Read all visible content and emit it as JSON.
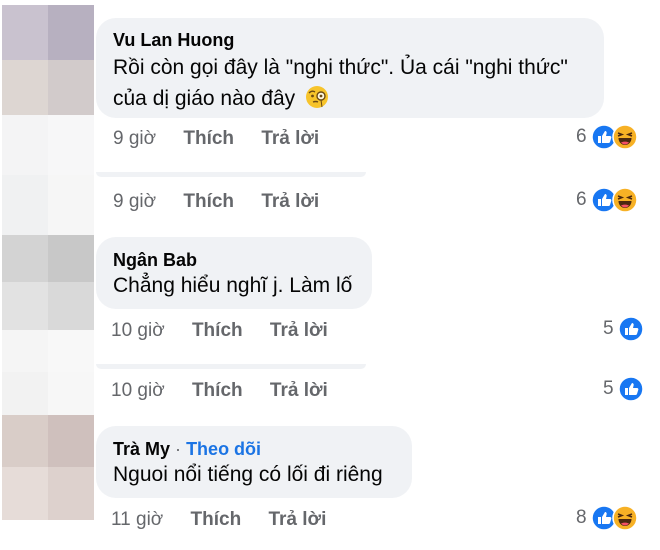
{
  "comments": [
    {
      "author": "Vu Lan Huong",
      "line1": "Rồi còn gọi đây là \"nghi thức\". Ủa cái \"nghi thức\"",
      "line2": "của dị giáo nào đây",
      "emoji": "face-with-monocle-icon",
      "time": "9 giờ",
      "like_label": "Thích",
      "reply_label": "Trả lời",
      "reaction_count": "6",
      "reactions": [
        "like-icon",
        "haha-icon"
      ]
    },
    {
      "time": "9 giờ",
      "like_label": "Thích",
      "reply_label": "Trả lời",
      "reaction_count": "6",
      "reactions": [
        "like-icon",
        "haha-icon"
      ]
    },
    {
      "author": "Ngân Bab",
      "line1": "Chẳng hiểu nghĩ j. Làm lố",
      "time": "10 giờ",
      "like_label": "Thích",
      "reply_label": "Trả lời",
      "reaction_count": "5",
      "reactions": [
        "like-icon"
      ]
    },
    {
      "time": "10 giờ",
      "like_label": "Thích",
      "reply_label": "Trả lời",
      "reaction_count": "5",
      "reactions": [
        "like-icon"
      ]
    },
    {
      "author": "Trà My",
      "separator": "·",
      "follow_label": "Theo dõi",
      "line1": "Nguoi nổi tiếng có lối đi riêng",
      "time": "11 giờ",
      "like_label": "Thích",
      "reply_label": "Trả lời",
      "reaction_count": "8",
      "reactions": [
        "like-icon",
        "haha-icon"
      ]
    }
  ],
  "colors": {
    "bubble": "#f0f2f5",
    "meta_text": "#65676b",
    "follow_link": "#1b74e4",
    "like_blue": "#1877f2",
    "haha_yellow": "#f7b125"
  }
}
